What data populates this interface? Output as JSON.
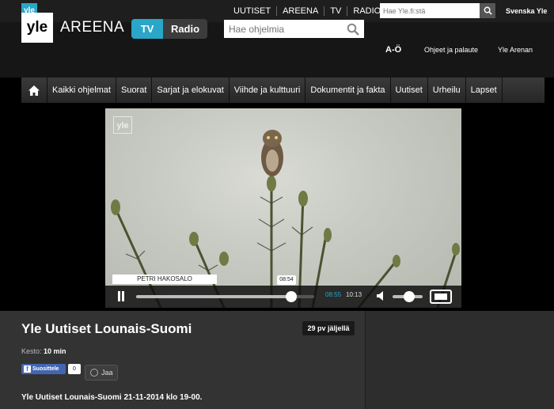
{
  "topbar": {
    "logo": "yle",
    "nav": [
      "UUTISET",
      "AREENA",
      "TV",
      "RADIO"
    ],
    "search_placeholder": "Hae Yle.fi:stä",
    "svenska": "Svenska Yle"
  },
  "header": {
    "logo": "yle",
    "title": "AREENA",
    "toggle_tv": "TV",
    "toggle_radio": "Radio",
    "search_placeholder": "Hae ohjelmia",
    "links": [
      "A-Ö",
      "Ohjeet ja palaute",
      "Yle Arenan"
    ]
  },
  "nav": {
    "items": [
      "Kaikki ohjelmat",
      "Suorat",
      "Sarjat ja elokuvat",
      "Viihde ja kulttuuri",
      "Dokumentit ja fakta",
      "Uutiset",
      "Urheilu",
      "Lapset"
    ]
  },
  "player": {
    "watermark": "yle",
    "credit": "PETRI HAKOSALO",
    "hover_time": "08:54",
    "current_time": "08:55",
    "total_time": "10:13",
    "progress": 0.873,
    "volume": 0.55
  },
  "program": {
    "title": "Yle Uutiset Lounais-Suomi",
    "days_left": "29 pv jäljellä",
    "duration_label": "Kesto:",
    "duration_value": "10 min",
    "fb_label": "Suosittele",
    "fb_count": "0",
    "share_label": "Jaa",
    "description": "Yle Uutiset Lounais-Suomi 21-11-2014 klo 19-00."
  },
  "colors": {
    "accent": "#2aa6c8",
    "facebook": "#4267b2"
  }
}
